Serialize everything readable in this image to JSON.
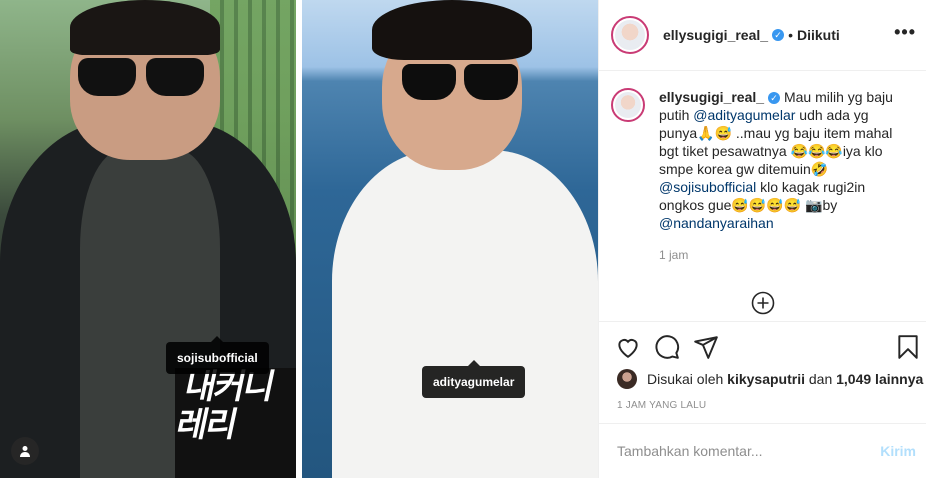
{
  "post": {
    "left_photo": {
      "overlay_text": "내커니 레리"
    },
    "tags": {
      "left": "sojisubofficial",
      "right": "adityagumelar"
    },
    "user_tag_icon": "person-icon"
  },
  "header": {
    "username": "ellysugigi_real_",
    "verified_icon": "verified-badge-icon",
    "separator": "•",
    "follow_status": "Diikuti",
    "more_icon": "more-options-icon"
  },
  "caption": {
    "username": "ellysugigi_real_",
    "segments": [
      {
        "text": "Mau milih yg baju putih ",
        "mention": false
      },
      {
        "text": "@adityagumelar",
        "mention": true
      },
      {
        "text": " udh ada yg punya🙏😅 ..mau yg baju item mahal bgt tiket pesawatnya 😂😂😂iya klo smpe korea gw ditemuin🤣 ",
        "mention": false
      },
      {
        "text": "@sojisubofficial",
        "mention": true
      },
      {
        "text": " klo kagak rugi2in ongkos gue😅😅😅😅 📷by ",
        "mention": false
      },
      {
        "text": "@nandanyaraihan",
        "mention": true
      }
    ],
    "time": "1 jam"
  },
  "load_more_icon": "plus-circle-icon",
  "actions": [
    "heart-icon",
    "comment-icon",
    "share-icon",
    "bookmark-icon"
  ],
  "likes": {
    "prefix": "Disukai oleh ",
    "user": "kikysaputrii",
    "middle": " dan ",
    "count": "1,049 lainnya"
  },
  "timestamp": "1 JAM YANG LALU",
  "add_comment": {
    "placeholder": "Tambahkan komentar...",
    "send_label": "Kirim"
  },
  "colors": {
    "mention": "#00376b",
    "verified": "#3897f0",
    "send_disabled": "#b2dffc"
  }
}
